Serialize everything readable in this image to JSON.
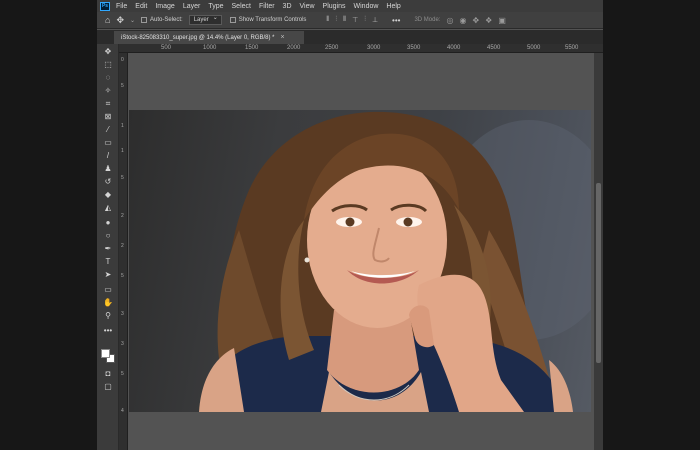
{
  "app": {
    "logo": "Ps"
  },
  "menu": [
    "File",
    "Edit",
    "Image",
    "Layer",
    "Type",
    "Select",
    "Filter",
    "3D",
    "View",
    "Plugins",
    "Window",
    "Help"
  ],
  "options": {
    "move_icon": "move-tool-icon",
    "auto_select_label": "Auto-Select:",
    "auto_select_value": "Layer",
    "show_transform_label": "Show Transform Controls",
    "more": "•••",
    "mode_3d_label": "3D Mode:"
  },
  "document": {
    "tab_title": "iStock-825083310_super.jpg @ 14.4% (Layer 0, RGB/8) *",
    "close": "×"
  },
  "ruler": {
    "top": [
      "500",
      "1000",
      "1500",
      "2000",
      "2500",
      "3000",
      "3500",
      "4000",
      "4500",
      "5000",
      "5500"
    ],
    "left": [
      "0",
      "5",
      "1",
      "1",
      "5",
      "2",
      "2",
      "5",
      "3",
      "3",
      "5",
      "4"
    ]
  },
  "tools": [
    "move-tool-icon",
    "marquee-tool-icon",
    "lasso-tool-icon",
    "magic-wand-icon",
    "crop-tool-icon",
    "frame-tool-icon",
    "eyedropper-icon",
    "healing-brush-icon",
    "brush-tool-icon",
    "clone-stamp-icon",
    "history-brush-icon",
    "eraser-icon",
    "paint-bucket-icon",
    "blur-tool-icon",
    "dodge-tool-icon",
    "pen-tool-icon",
    "type-tool-icon",
    "path-select-icon",
    "rectangle-tool-icon",
    "hand-tool-icon",
    "zoom-tool-icon",
    "more-tools-icon"
  ],
  "colors": {
    "foreground": "#ffffff",
    "background": "#ffffff"
  }
}
